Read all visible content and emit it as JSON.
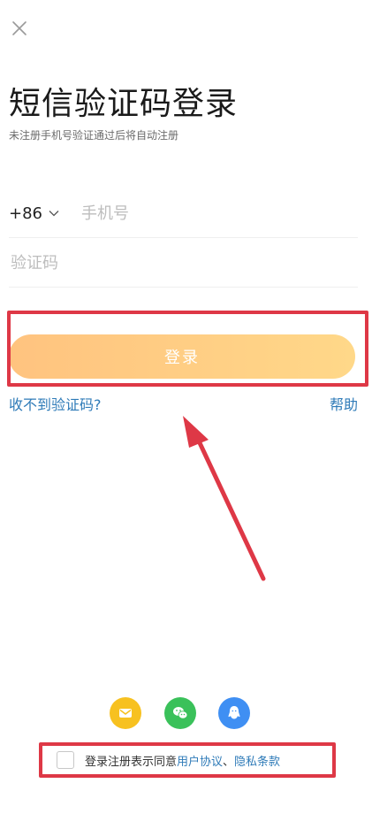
{
  "header": {
    "close_icon": "close-icon"
  },
  "title": "短信验证码登录",
  "subtitle": "未注册手机号验证通过后将自动注册",
  "phone": {
    "country_code": "+86",
    "placeholder": "手机号",
    "value": ""
  },
  "code": {
    "placeholder": "验证码",
    "value": ""
  },
  "login_button": "登录",
  "links": {
    "no_code": "收不到验证码?",
    "help": "帮助"
  },
  "social": [
    {
      "icon": "mail-icon",
      "color": "#f7c120"
    },
    {
      "icon": "wechat-icon",
      "color": "#3ac15a"
    },
    {
      "icon": "qq-icon",
      "color": "#3f8ff3"
    }
  ],
  "agreement": {
    "prefix": "登录注册表示同意",
    "user_agreement": "用户协议",
    "separator": "、",
    "privacy": "隐私条款"
  },
  "colors": {
    "accent": "#ffc37f",
    "link": "#2f7bb8",
    "annotation": "#de3846"
  }
}
